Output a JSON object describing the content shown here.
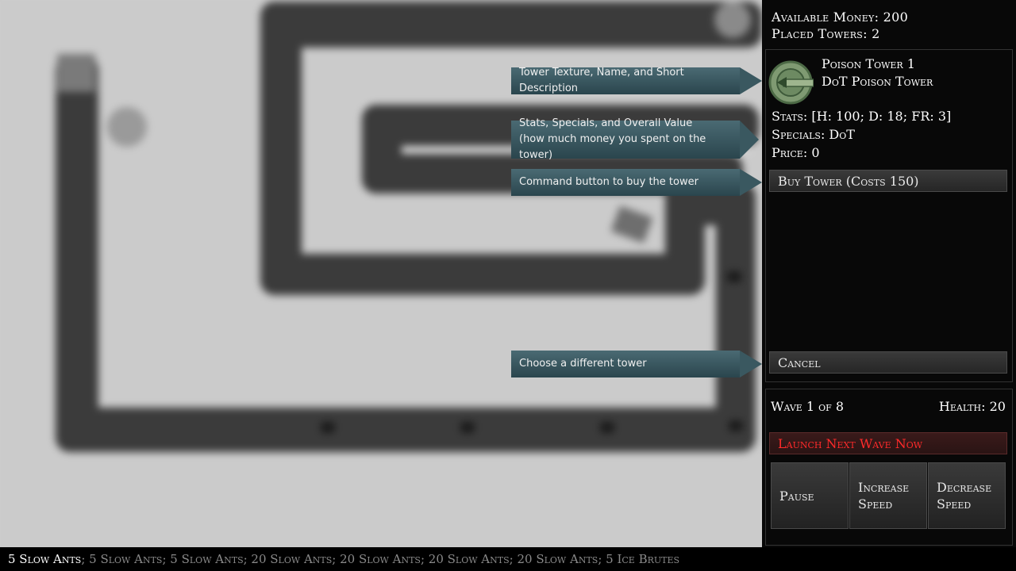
{
  "stats": {
    "money_label": "Available Money: 200",
    "towers_label": "Placed Towers: 2"
  },
  "tower": {
    "name": "Poison Tower 1",
    "description": "DoT Poison Tower",
    "stats_label": "Stats: [H: 100; D: 18; FR: 3]",
    "specials_label": "Specials: DoT",
    "price_label": "Price: 0",
    "icon": "poison-tower-icon"
  },
  "buttons": {
    "buy": "Buy Tower (Costs 150)",
    "cancel": "Cancel",
    "launch": "Launch Next Wave Now",
    "pause": "Pause",
    "increase_1": "Increase",
    "increase_2": "Speed",
    "decrease_1": "Decrease",
    "decrease_2": "Speed"
  },
  "wave": {
    "label": "Wave 1 of 8",
    "health": "Health: 20"
  },
  "callouts": {
    "texture": "Tower Texture, Name, and Short Description",
    "stats_1": "Stats, Specials, and Overall Value",
    "stats_2": "(how much money you spent on the tower)",
    "buy": "Command button to buy the tower",
    "cancel": "Choose a different tower"
  },
  "wave_list": {
    "current": "5 Slow Ants",
    "rest": "; 5 Slow Ants; 5 Slow Ants; 20 Slow Ants; 20 Slow Ants; 20 Slow Ants; 20 Slow Ants; 5 Ice Brutes"
  },
  "colors": {
    "launch_text": "#ff2a2a",
    "callout": "#3a5860",
    "path": "#3b3b3b"
  }
}
